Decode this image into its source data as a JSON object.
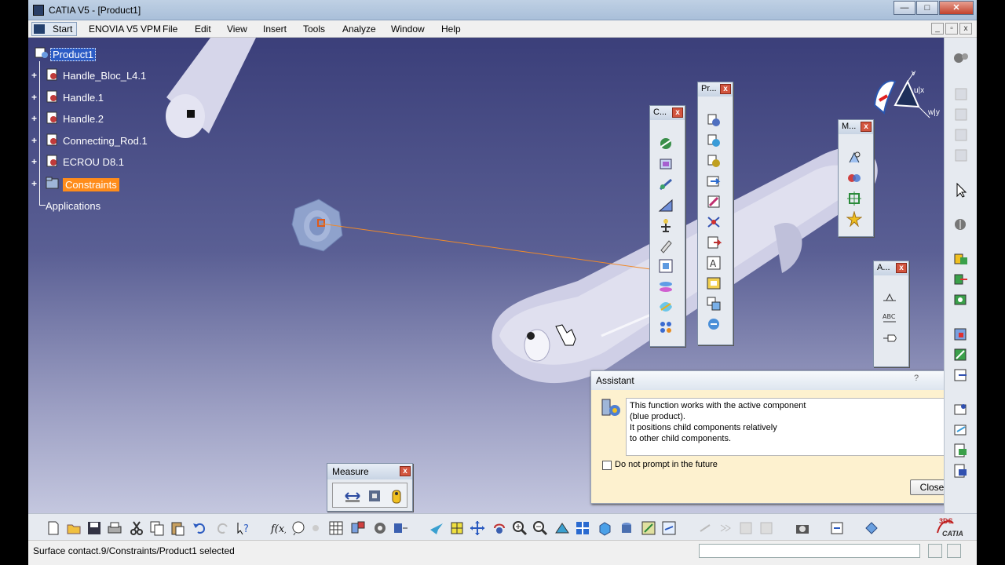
{
  "window": {
    "title": "CATIA V5 - [Product1]",
    "controls": [
      "—",
      "□",
      "✕"
    ]
  },
  "menubar": {
    "items": [
      "Start",
      "ENOVIA V5 VPM",
      "File",
      "Edit",
      "View",
      "Insert",
      "Tools",
      "Analyze",
      "Window",
      "Help"
    ],
    "mdi_controls": [
      "_",
      "▫",
      "x"
    ]
  },
  "tree": {
    "root": "Product1",
    "children": [
      "Handle_Bloc_L4.1",
      "Handle.1",
      "Handle.2",
      "Connecting_Rod.1",
      "ECROU D8.1",
      "Constraints"
    ],
    "applications": "Applications"
  },
  "floating_toolbars": {
    "constraints_title": "C...",
    "product_title": "Pr...",
    "move_title": "M...",
    "annotations_title": "A...",
    "close_symbol": "x"
  },
  "measure_toolbar": {
    "title": "Measure"
  },
  "assistant": {
    "title": "Assistant",
    "message_lines": [
      "This function works with the active component",
      "(blue product).",
      "It positions child components relatively",
      "to other child components."
    ],
    "checkbox_label": "Do not prompt in the future",
    "close_button": "Close",
    "close_symbol": "✕",
    "help_symbol": "?"
  },
  "compass_labels": {
    "v": "v",
    "u": "u|x",
    "w": "w|y"
  },
  "status": {
    "text": "Surface contact.9/Constraints/Product1 selected"
  },
  "brand": {
    "name": "CATIA",
    "code": "3DS"
  },
  "colors": {
    "selection_blue": "#2c5cc5",
    "constraint_orange": "#ff8c1a",
    "viewport_top": "#3b3f7a",
    "viewport_bottom": "#c4c7df",
    "assistant_bg": "#fdf1cf"
  }
}
